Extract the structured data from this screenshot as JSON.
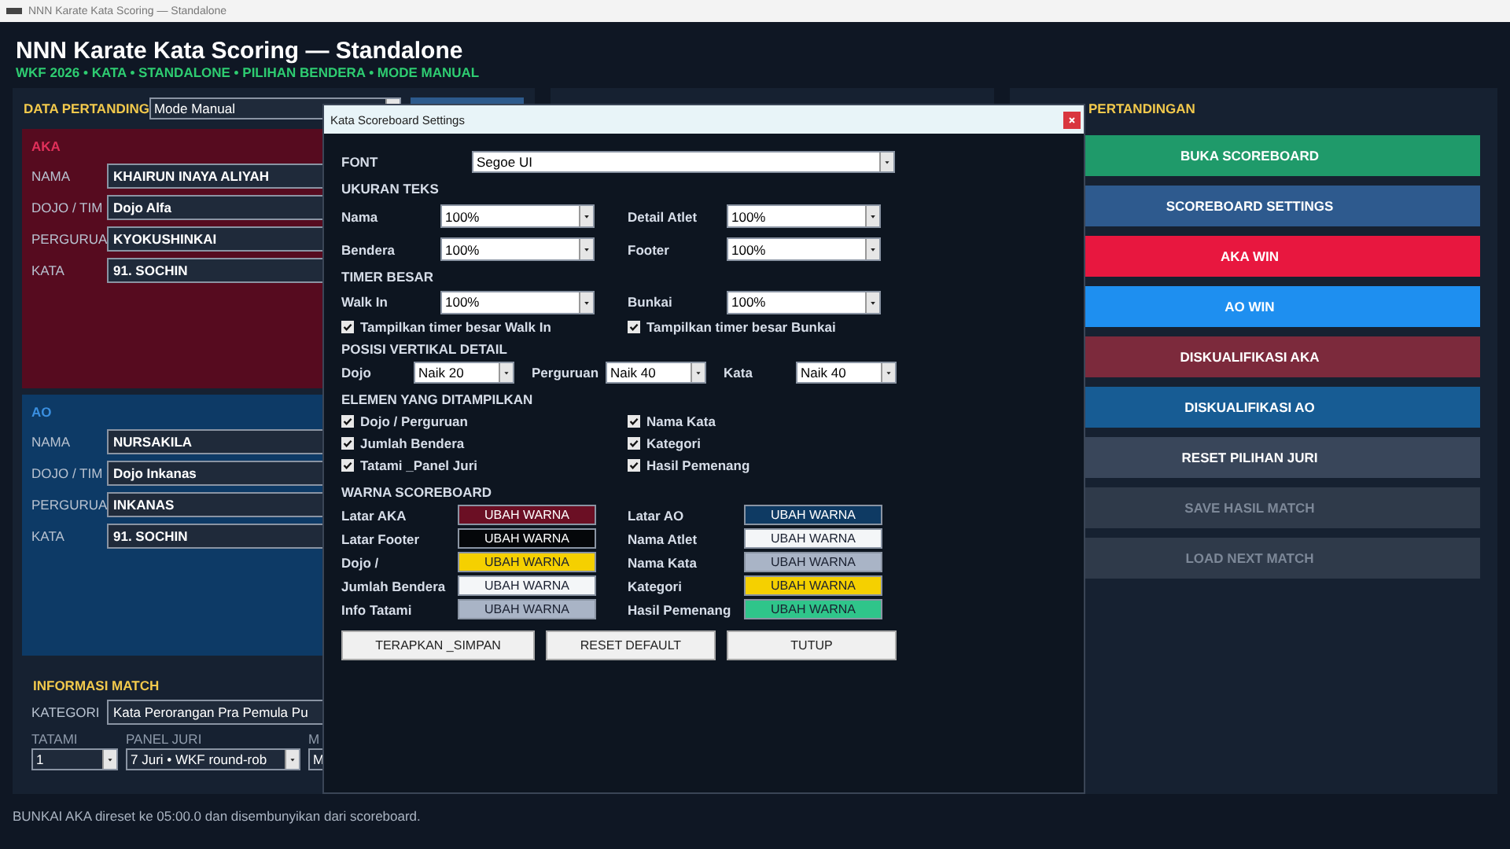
{
  "window": {
    "title": "NNN Karate Kata Scoring — Standalone"
  },
  "header": {
    "title": "NNN Karate Kata Scoring — Standalone",
    "subtitle": "WKF 2026 • KATA • STANDALONE • PILIHAN BENDERA • MODE MANUAL"
  },
  "match_data": {
    "title": "DATA PERTANDING",
    "mode": "Mode Manual",
    "aka": {
      "label": "AKA",
      "fields": [
        {
          "label": "NAMA",
          "value": "KHAIRUN INAYA ALIYAH"
        },
        {
          "label": "DOJO / TIM",
          "value": "Dojo Alfa"
        },
        {
          "label": "PERGURUA",
          "value": "KYOKUSHINKAI"
        },
        {
          "label": "KATA",
          "value": "91. SOCHIN"
        }
      ]
    },
    "ao": {
      "label": "AO",
      "fields": [
        {
          "label": "NAMA",
          "value": "NURSAKILA"
        },
        {
          "label": "DOJO / TIM",
          "value": "Dojo Inkanas"
        },
        {
          "label": "PERGURUA",
          "value": "INKANAS"
        },
        {
          "label": "KATA",
          "value": "91. SOCHIN"
        }
      ]
    },
    "match_info": {
      "title": "INFORMASI MATCH",
      "category_label": "KATEGORI",
      "category": "Kata Perorangan Pra Pemula Pu",
      "selects": [
        {
          "label": "TATAMI",
          "value": "1"
        },
        {
          "label": "PANEL JURI",
          "value": "7 Juri • WKF round-rob"
        },
        {
          "label": "M",
          "value": "M"
        }
      ]
    }
  },
  "control": {
    "title": "PERTANDINGAN",
    "buttons": [
      {
        "label": "BUKA SCOREBOARD",
        "color": "#1f9a6a",
        "disabled": false
      },
      {
        "label": "SCOREBOARD SETTINGS",
        "color": "#2e5a8e",
        "disabled": false
      },
      {
        "label": "AKA WIN",
        "color": "#e8173f",
        "disabled": false
      },
      {
        "label": "AO WIN",
        "color": "#1e8ff0",
        "disabled": false
      },
      {
        "label": "DISKUALIFIKASI AKA",
        "color": "#7c2a3c",
        "disabled": false
      },
      {
        "label": "DISKUALIFIKASI AO",
        "color": "#175c94",
        "disabled": false
      },
      {
        "label": "RESET PILIHAN JURI",
        "color": "#39465a",
        "disabled": false
      },
      {
        "label": "SAVE HASIL MATCH",
        "color": "#2f3a4a",
        "disabled": true
      },
      {
        "label": "LOAD NEXT MATCH",
        "color": "#2f3a4a",
        "disabled": true
      }
    ]
  },
  "dialog": {
    "title": "Kata Scoreboard Settings",
    "font": {
      "label": "FONT",
      "value": "Segoe UI"
    },
    "text_size": {
      "heading": "UKURAN TEKS",
      "fields": [
        {
          "label": "Nama",
          "value": "100%"
        },
        {
          "label": "Detail Atlet",
          "value": "100%"
        },
        {
          "label": "Bendera",
          "value": "100%"
        },
        {
          "label": "Footer",
          "value": "100%"
        }
      ]
    },
    "big_timer": {
      "heading": "TIMER BESAR",
      "fields": [
        {
          "label": "Walk In",
          "value": "100%"
        },
        {
          "label": "Bunkai",
          "value": "100%"
        }
      ],
      "checkboxes": [
        {
          "label": "Tampilkan timer besar Walk In",
          "checked": true
        },
        {
          "label": "Tampilkan timer besar Bunkai",
          "checked": true
        }
      ]
    },
    "vertical_position": {
      "heading": "POSISI VERTIKAL DETAIL",
      "fields": [
        {
          "label": "Dojo",
          "value": "Naik 20"
        },
        {
          "label": "Perguruan",
          "value": "Naik 40"
        },
        {
          "label": "Kata",
          "value": "Naik 40"
        }
      ]
    },
    "elements": {
      "heading": "ELEMEN YANG DITAMPILKAN",
      "items": [
        {
          "label": "Dojo / Perguruan",
          "checked": true
        },
        {
          "label": "Nama Kata",
          "checked": true
        },
        {
          "label": "Jumlah Bendera",
          "checked": true
        },
        {
          "label": "Kategori",
          "checked": true
        },
        {
          "label": "Tatami _Panel Juri",
          "checked": true
        },
        {
          "label": "Hasil Pemenang",
          "checked": true
        }
      ]
    },
    "colors": {
      "heading": "WARNA SCOREBOARD",
      "items": [
        {
          "label": "Latar AKA",
          "button": "UBAH WARNA",
          "color": "#6b0f24"
        },
        {
          "label": "Latar AO",
          "button": "UBAH WARNA",
          "color": "#0e3a63"
        },
        {
          "label": "Latar Footer",
          "button": "UBAH WARNA",
          "color": "#05070a"
        },
        {
          "label": "Nama Atlet",
          "button": "UBAH WARNA",
          "color": "#f4f6f8"
        },
        {
          "label": "Dojo /",
          "button": "UBAH WARNA",
          "color": "#f5d000"
        },
        {
          "label": "Nama Kata",
          "button": "UBAH WARNA",
          "color": "#a9b4c6"
        },
        {
          "label": "Jumlah Bendera",
          "button": "UBAH WARNA",
          "color": "#f4f6f8"
        },
        {
          "label": "Kategori",
          "button": "UBAH WARNA",
          "color": "#f5d000"
        },
        {
          "label": "Info Tatami",
          "button": "UBAH WARNA",
          "color": "#a9b4c6"
        },
        {
          "label": "Hasil Pemenang",
          "button": "UBAH WARNA",
          "color": "#2fc58a"
        }
      ]
    },
    "buttons": [
      "TERAPKAN _SIMPAN",
      "RESET DEFAULT",
      "TUTUP"
    ]
  },
  "status_bar": "BUNKAI AKA direset ke 05:00.0 dan disembunyikan dari scoreboard."
}
